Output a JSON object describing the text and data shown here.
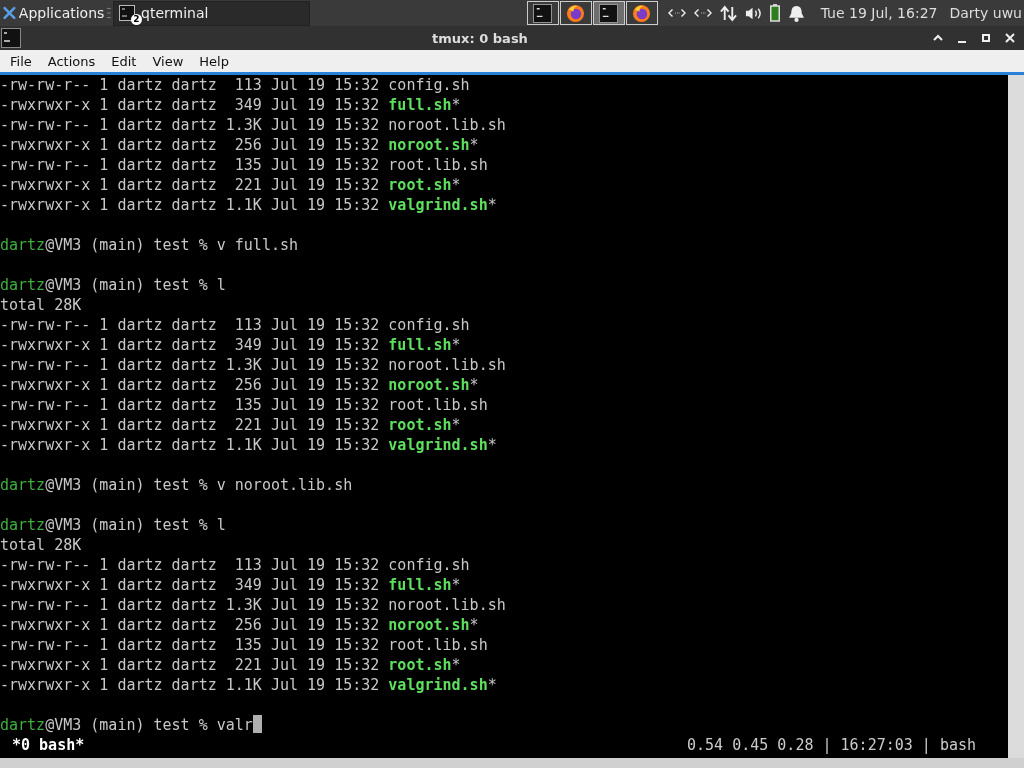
{
  "panel": {
    "applications": "Applications",
    "task": {
      "title": "qterminal",
      "count": "2"
    },
    "launchers": [
      {
        "kind": "terminal",
        "selected": false
      },
      {
        "kind": "browser",
        "selected": false
      },
      {
        "kind": "terminal",
        "selected": true
      },
      {
        "kind": "browser",
        "selected": false
      }
    ],
    "clock": "Tue 19 Jul, 16:27",
    "user": "Darty uwu"
  },
  "window": {
    "title": "tmux: 0 bash"
  },
  "menu": [
    "File",
    "Actions",
    "Edit",
    "View",
    "Help"
  ],
  "terminal": {
    "lines": [
      {
        "kind": "file",
        "meta": "-rw-rw-r-- 1 dartz dartz  113 Jul 19 15:32 ",
        "name": "config.sh",
        "executable": false
      },
      {
        "kind": "file",
        "meta": "-rwxrwxr-x 1 dartz dartz  349 Jul 19 15:32 ",
        "name": "full.sh",
        "executable": true,
        "suffix": "*"
      },
      {
        "kind": "file",
        "meta": "-rw-rw-r-- 1 dartz dartz 1.3K Jul 19 15:32 ",
        "name": "noroot.lib.sh",
        "executable": false
      },
      {
        "kind": "file",
        "meta": "-rwxrwxr-x 1 dartz dartz  256 Jul 19 15:32 ",
        "name": "noroot.sh",
        "executable": true,
        "suffix": "*"
      },
      {
        "kind": "file",
        "meta": "-rw-rw-r-- 1 dartz dartz  135 Jul 19 15:32 ",
        "name": "root.lib.sh",
        "executable": false
      },
      {
        "kind": "file",
        "meta": "-rwxrwxr-x 1 dartz dartz  221 Jul 19 15:32 ",
        "name": "root.sh",
        "executable": true,
        "suffix": "*"
      },
      {
        "kind": "file",
        "meta": "-rwxrwxr-x 1 dartz dartz 1.1K Jul 19 15:32 ",
        "name": "valgrind.sh",
        "executable": true,
        "suffix": "*"
      },
      {
        "kind": "blank"
      },
      {
        "kind": "prompt",
        "user": "dartz",
        "rest": "@VM3 (main) test % v full.sh"
      },
      {
        "kind": "blank"
      },
      {
        "kind": "prompt",
        "user": "dartz",
        "rest": "@VM3 (main) test % l"
      },
      {
        "kind": "text",
        "text": "total 28K"
      },
      {
        "kind": "file",
        "meta": "-rw-rw-r-- 1 dartz dartz  113 Jul 19 15:32 ",
        "name": "config.sh",
        "executable": false
      },
      {
        "kind": "file",
        "meta": "-rwxrwxr-x 1 dartz dartz  349 Jul 19 15:32 ",
        "name": "full.sh",
        "executable": true,
        "suffix": "*"
      },
      {
        "kind": "file",
        "meta": "-rw-rw-r-- 1 dartz dartz 1.3K Jul 19 15:32 ",
        "name": "noroot.lib.sh",
        "executable": false
      },
      {
        "kind": "file",
        "meta": "-rwxrwxr-x 1 dartz dartz  256 Jul 19 15:32 ",
        "name": "noroot.sh",
        "executable": true,
        "suffix": "*"
      },
      {
        "kind": "file",
        "meta": "-rw-rw-r-- 1 dartz dartz  135 Jul 19 15:32 ",
        "name": "root.lib.sh",
        "executable": false
      },
      {
        "kind": "file",
        "meta": "-rwxrwxr-x 1 dartz dartz  221 Jul 19 15:32 ",
        "name": "root.sh",
        "executable": true,
        "suffix": "*"
      },
      {
        "kind": "file",
        "meta": "-rwxrwxr-x 1 dartz dartz 1.1K Jul 19 15:32 ",
        "name": "valgrind.sh",
        "executable": true,
        "suffix": "*"
      },
      {
        "kind": "blank"
      },
      {
        "kind": "prompt",
        "user": "dartz",
        "rest": "@VM3 (main) test % v noroot.lib.sh"
      },
      {
        "kind": "blank"
      },
      {
        "kind": "prompt",
        "user": "dartz",
        "rest": "@VM3 (main) test % l"
      },
      {
        "kind": "text",
        "text": "total 28K"
      },
      {
        "kind": "file",
        "meta": "-rw-rw-r-- 1 dartz dartz  113 Jul 19 15:32 ",
        "name": "config.sh",
        "executable": false
      },
      {
        "kind": "file",
        "meta": "-rwxrwxr-x 1 dartz dartz  349 Jul 19 15:32 ",
        "name": "full.sh",
        "executable": true,
        "suffix": "*"
      },
      {
        "kind": "file",
        "meta": "-rw-rw-r-- 1 dartz dartz 1.3K Jul 19 15:32 ",
        "name": "noroot.lib.sh",
        "executable": false
      },
      {
        "kind": "file",
        "meta": "-rwxrwxr-x 1 dartz dartz  256 Jul 19 15:32 ",
        "name": "noroot.sh",
        "executable": true,
        "suffix": "*"
      },
      {
        "kind": "file",
        "meta": "-rw-rw-r-- 1 dartz dartz  135 Jul 19 15:32 ",
        "name": "root.lib.sh",
        "executable": false
      },
      {
        "kind": "file",
        "meta": "-rwxrwxr-x 1 dartz dartz  221 Jul 19 15:32 ",
        "name": "root.sh",
        "executable": true,
        "suffix": "*"
      },
      {
        "kind": "file",
        "meta": "-rwxrwxr-x 1 dartz dartz 1.1K Jul 19 15:32 ",
        "name": "valgrind.sh",
        "executable": true,
        "suffix": "*"
      },
      {
        "kind": "blank"
      },
      {
        "kind": "prompt",
        "user": "dartz",
        "rest": "@VM3 (main) test % valr",
        "cursor": true
      }
    ]
  },
  "status_bar": {
    "window": "*0 bash*",
    "info": "0.54 0.45 0.28 | 16:27:03 | bash"
  }
}
